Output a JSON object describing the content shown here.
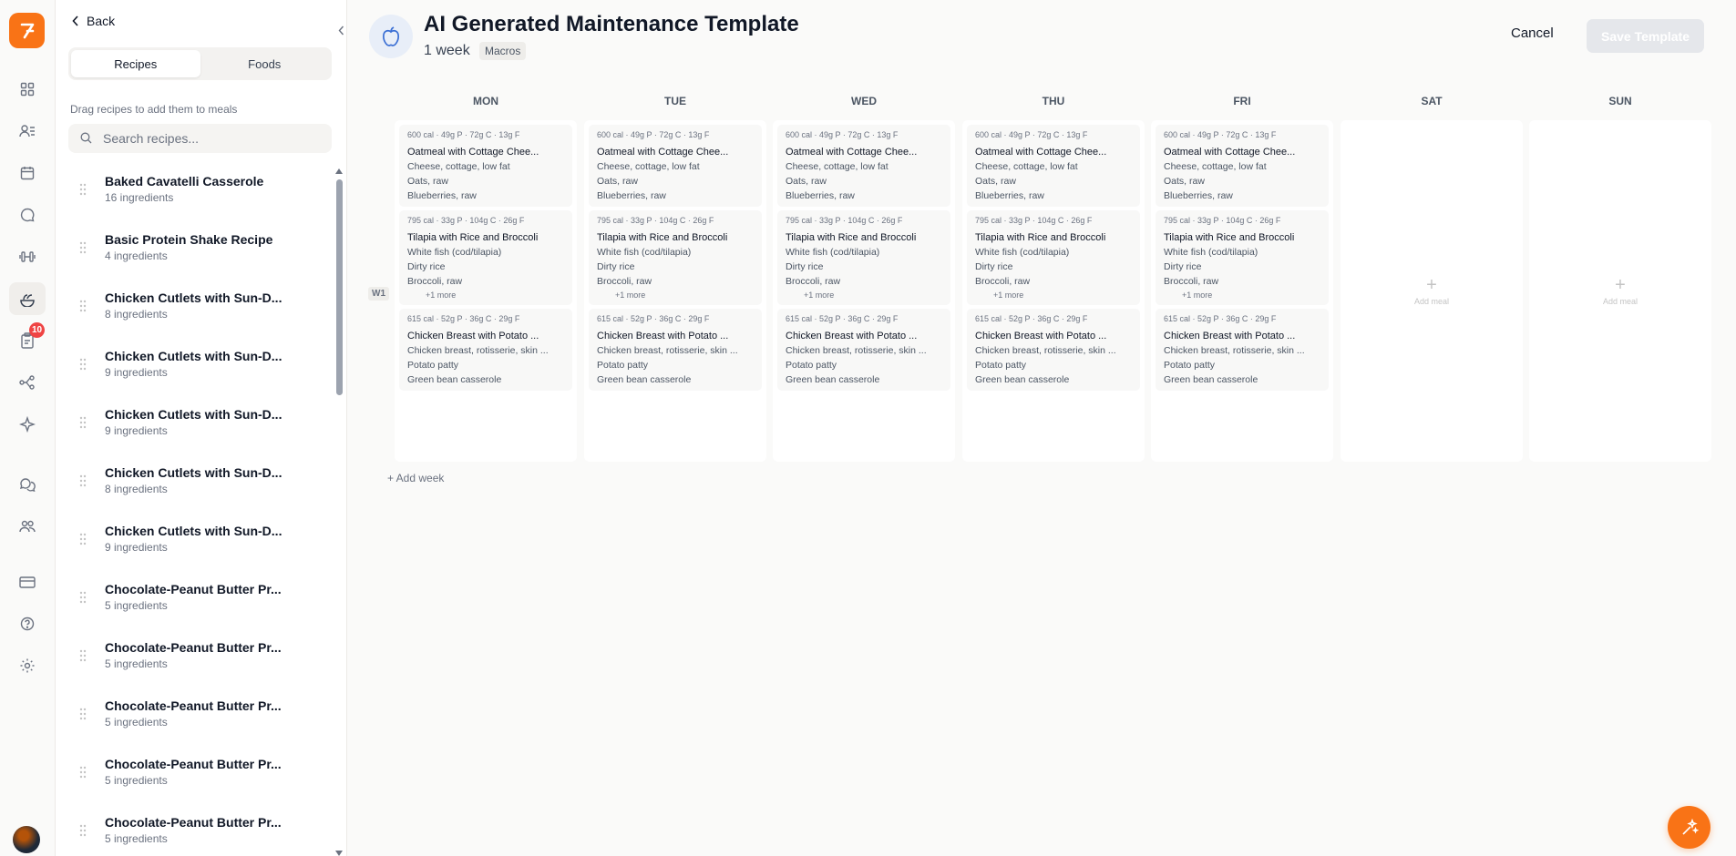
{
  "rail": {
    "badge_count": "10"
  },
  "library": {
    "back_label": "Back",
    "tabs": [
      {
        "label": "Recipes"
      },
      {
        "label": "Foods"
      }
    ],
    "hint": "Drag recipes to add them to meals",
    "search_placeholder": "Search recipes...",
    "recipes": [
      {
        "name": "Baked Cavatelli Casserole",
        "count": "16 ingredients"
      },
      {
        "name": "Basic Protein Shake Recipe",
        "count": "4 ingredients"
      },
      {
        "name": "Chicken Cutlets with Sun-D...",
        "count": "8 ingredients"
      },
      {
        "name": "Chicken Cutlets with Sun-D...",
        "count": "9 ingredients"
      },
      {
        "name": "Chicken Cutlets with Sun-D...",
        "count": "9 ingredients"
      },
      {
        "name": "Chicken Cutlets with Sun-D...",
        "count": "8 ingredients"
      },
      {
        "name": "Chicken Cutlets with Sun-D...",
        "count": "9 ingredients"
      },
      {
        "name": "Chocolate-Peanut Butter Pr...",
        "count": "5 ingredients"
      },
      {
        "name": "Chocolate-Peanut Butter Pr...",
        "count": "5 ingredients"
      },
      {
        "name": "Chocolate-Peanut Butter Pr...",
        "count": "5 ingredients"
      },
      {
        "name": "Chocolate-Peanut Butter Pr...",
        "count": "5 ingredients"
      },
      {
        "name": "Chocolate-Peanut Butter Pr...",
        "count": "5 ingredients"
      }
    ]
  },
  "header": {
    "title": "AI Generated Maintenance Template",
    "weeks": "1 week",
    "tag": "Macros",
    "cancel_label": "Cancel",
    "save_label": "Save Template"
  },
  "week_label": "W1",
  "days": [
    "MON",
    "TUE",
    "WED",
    "THU",
    "FRI",
    "SAT",
    "SUN"
  ],
  "meals": [
    {
      "macro": "600 cal · 49g P · 72g C · 13g F",
      "name": "Oatmeal with Cottage Chee...",
      "ingredients": [
        "Cheese, cottage, low fat",
        "Oats, raw",
        "Blueberries, raw"
      ],
      "more": ""
    },
    {
      "macro": "795 cal · 33g P · 104g C · 26g F",
      "name": "Tilapia with Rice and Broccoli",
      "ingredients": [
        "White fish (cod/tilapia)",
        "Dirty rice",
        "Broccoli, raw"
      ],
      "more": "+1 more"
    },
    {
      "macro": "615 cal · 52g P · 36g C · 29g F",
      "name": "Chicken Breast with Potato ...",
      "ingredients": [
        "Chicken breast, rotisserie, skin ...",
        "Potato patty",
        "Green bean casserole"
      ],
      "more": ""
    }
  ],
  "add_meal_label": "Add meal",
  "add_week_label": "+ Add week"
}
